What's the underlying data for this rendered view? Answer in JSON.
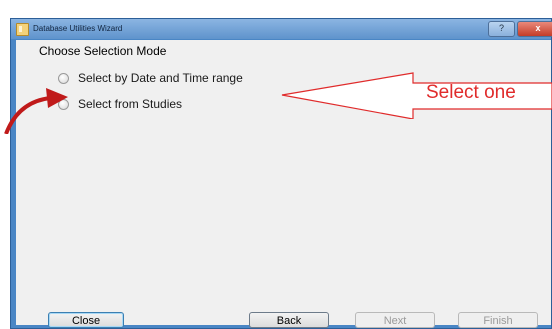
{
  "window": {
    "title": "Database Utilities Wizard",
    "help_glyph": "?",
    "close_glyph": "x"
  },
  "page": {
    "heading": "Choose Selection Mode"
  },
  "options": [
    {
      "label": "Select by Date and Time range",
      "selected": false
    },
    {
      "label": "Select from Studies",
      "selected": false
    }
  ],
  "annotation": {
    "text": "Select one",
    "color": "#e02b2b"
  },
  "buttons": {
    "close": "Close",
    "back": "Back",
    "next": "Next",
    "finish": "Finish"
  },
  "colors": {
    "window_frame": "#4a86c5",
    "client_bg": "#f0f0f0",
    "annotation_red": "#e02b2b",
    "arrow_red": "#c01a1a"
  }
}
